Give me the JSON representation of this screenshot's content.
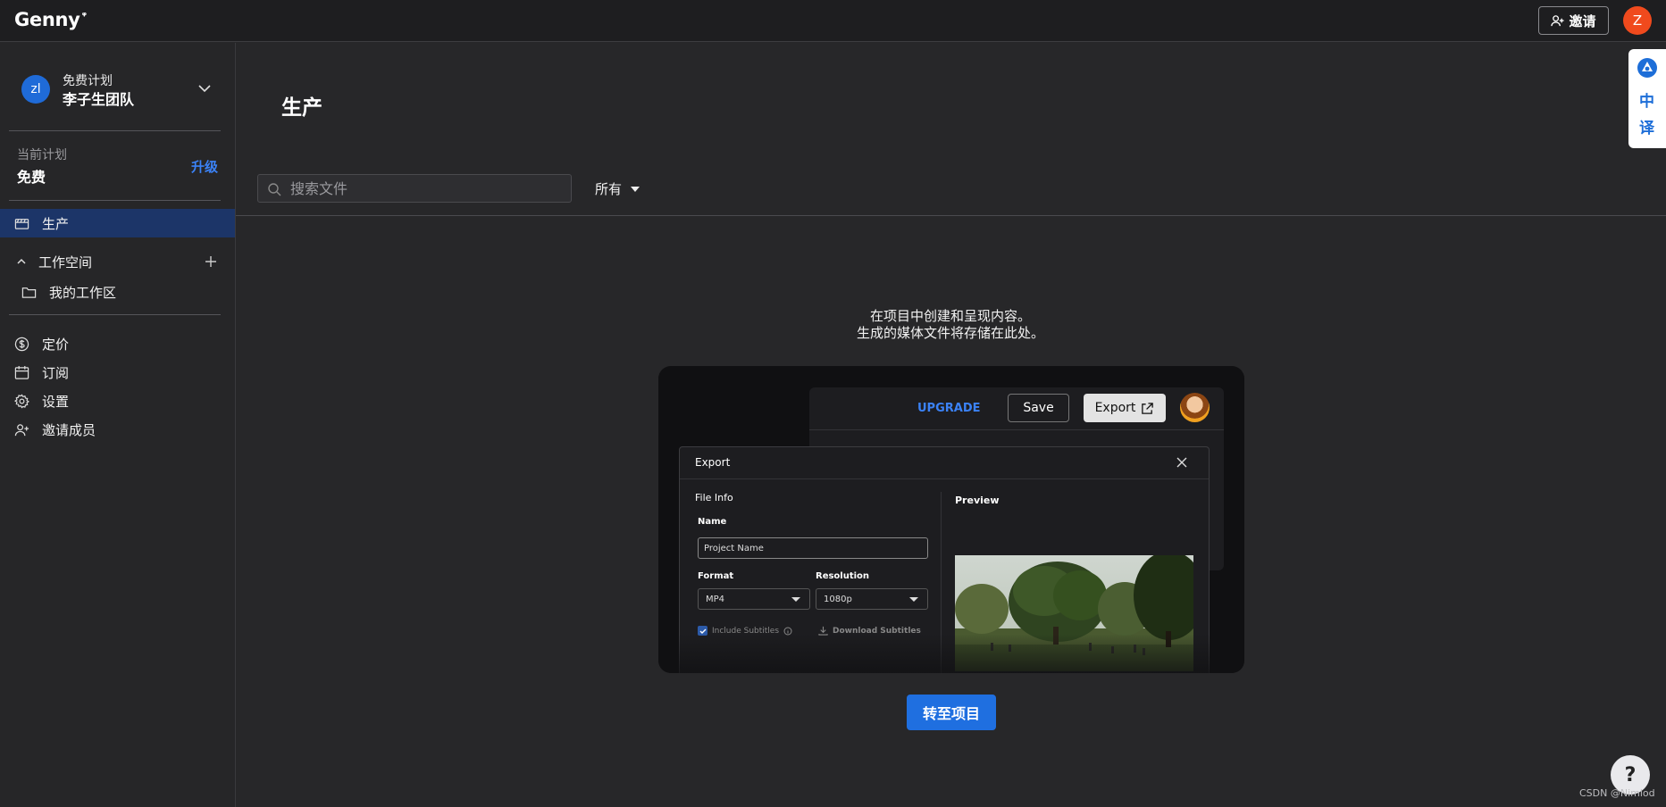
{
  "topbar": {
    "brand": "Genny",
    "invite_label": "邀请",
    "user_initial": "Z"
  },
  "sidebar": {
    "team": {
      "initials": "zl",
      "plan": "免费计划",
      "name": "李子生团队"
    },
    "plan": {
      "label": "当前计划",
      "value": "免费",
      "upgrade_label": "升级"
    },
    "production_label": "生产",
    "workspace": {
      "section_label": "工作空间",
      "item_label": "我的工作区"
    },
    "links": [
      "定价",
      "订阅",
      "设置",
      "邀请成员"
    ]
  },
  "main": {
    "title": "生产",
    "search_placeholder": "搜索文件",
    "filter_label": "所有",
    "empty_line1": "在项目中创建和呈现内容。",
    "empty_line2": "生成的媒体文件将存储在此处。",
    "goto_button": "转至项目"
  },
  "illustration": {
    "upgrade": "UPGRADE",
    "save": "Save",
    "export": "Export",
    "dialog_title": "Export",
    "file_info": "File Info",
    "name_label": "Name",
    "name_value": "Project Name",
    "format_label": "Format",
    "format_value": "MP4",
    "resolution_label": "Resolution",
    "resolution_value": "1080p",
    "include_subtitles": "Include Subtitles",
    "download_subtitles": "Download Subtitles",
    "preview_label": "Preview"
  },
  "translate_widget": {
    "char1": "中",
    "char2": "译"
  },
  "help": {
    "label": "?"
  },
  "watermark": "CSDN @Nimlod",
  "colors": {
    "accent": "#1f6fe0",
    "active_nav": "#1c3568",
    "user_avatar": "#f04a1d",
    "link": "#3b82f6"
  }
}
